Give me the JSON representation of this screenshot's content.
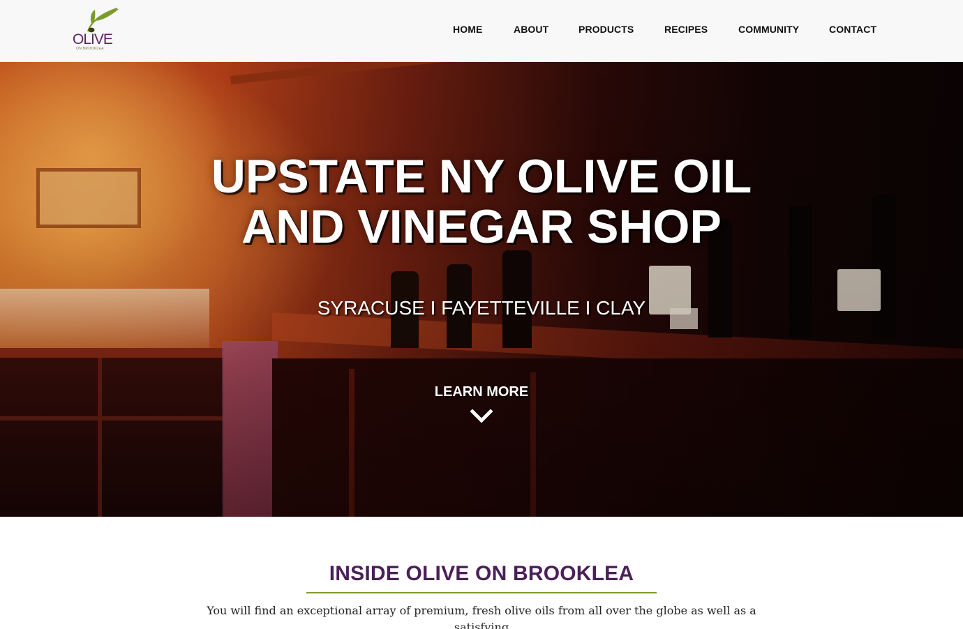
{
  "brand": {
    "logo_word": "OLIVE",
    "logo_subtext": "ON BROOKLEA",
    "logo_icon": "olive-branch-icon",
    "colors": {
      "purple": "#4a2058",
      "olive_green": "#7d9a2e"
    }
  },
  "nav": {
    "items": [
      {
        "label": "HOME"
      },
      {
        "label": "ABOUT"
      },
      {
        "label": "PRODUCTS"
      },
      {
        "label": "RECIPES"
      },
      {
        "label": "COMMUNITY"
      },
      {
        "label": "CONTACT"
      }
    ]
  },
  "hero": {
    "title_line1": "UPSTATE NY OLIVE OIL",
    "title_line2": "AND VINEGAR SHOP",
    "locations": "SYRACUSE I FAYETTEVILLE I CLAY",
    "cta_label": "LEARN MORE",
    "cta_icon": "chevron-down-icon"
  },
  "intro": {
    "heading": "INSIDE OLIVE ON BROOKLEA",
    "body": "You will find an exceptional array of premium, fresh olive oils from all over the globe as well as a satisfying"
  }
}
